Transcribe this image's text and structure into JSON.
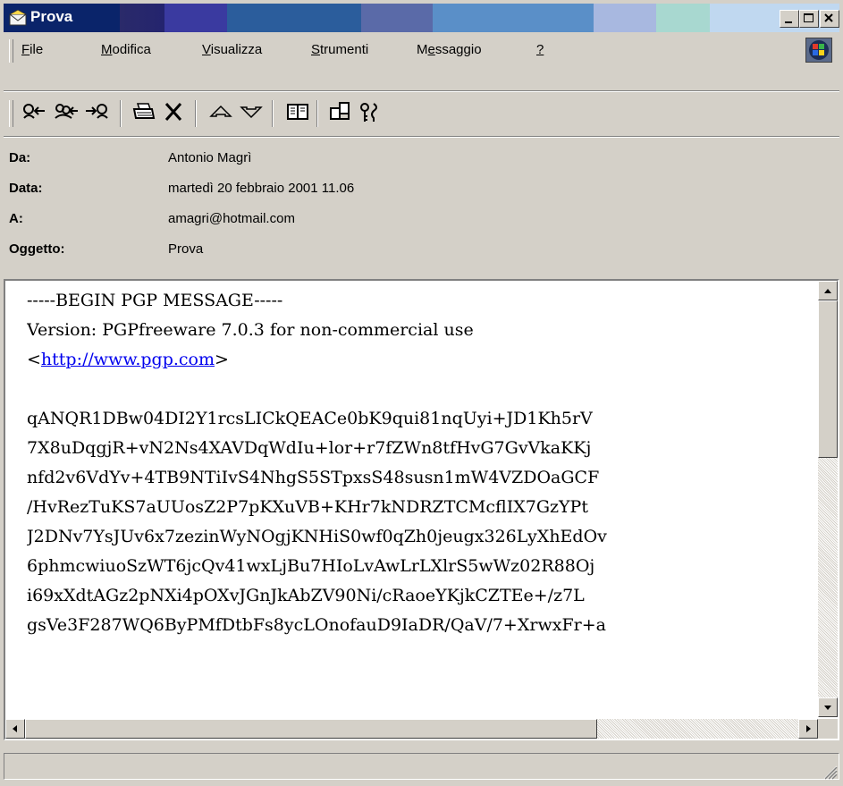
{
  "window": {
    "title": "Prova",
    "controls": {
      "minimize": "minimize-icon",
      "maximize": "maximize-icon",
      "close": "close-icon"
    }
  },
  "menu": {
    "items": [
      {
        "label": "File",
        "accel": "F"
      },
      {
        "label": "Modifica",
        "accel": "M"
      },
      {
        "label": "Visualizza",
        "accel": "V"
      },
      {
        "label": "Strumenti",
        "accel": "S"
      },
      {
        "label": "Messaggio",
        "accel": "e"
      },
      {
        "label": "?",
        "accel": "?"
      }
    ]
  },
  "toolbar": {
    "buttons": [
      "reply-icon",
      "reply-all-icon",
      "forward-icon",
      "print-icon",
      "delete-icon",
      "previous-icon",
      "next-icon",
      "address-book-icon",
      "encoding-icon",
      "security-icon"
    ]
  },
  "header": {
    "from_label": "Da:",
    "from_value": "Antonio Magrì",
    "date_label": "Data:",
    "date_value": "martedì 20 febbraio 2001 11.06",
    "to_label": "A:",
    "to_value": "amagri@hotmail.com",
    "subject_label": "Oggetto:",
    "subject_value": "Prova"
  },
  "message": {
    "line1": "-----BEGIN PGP MESSAGE-----",
    "line2": "Version: PGPfreeware 7.0.3 for non-commercial use",
    "link_prefix": "<",
    "link_text": "http://www.pgp.com",
    "link_suffix": ">",
    "body_lines": [
      "qANQR1DBw04DI2Y1rcsLICkQEACe0bK9qui81nqUyi+JD1Kh5rV",
      "7X8uDqgjR+vN2Ns4XAVDqWdIu+lor+r7fZWn8tfHvG7GvVkaKKj",
      "nfd2v6VdYv+4TB9NTiIvS4NhgS5STpxsS48susn1mW4VZDOaGCF",
      "/HvRezTuKS7aUUosZ2P7pKXuVB+KHr7kNDRZTCMcflIX7GzYPt",
      "J2DNv7YsJUv6x7zezinWyNOgjKNHiS0wf0qZh0jeugx326LyXhEdOv",
      "6phmcwiuoSzWT6jcQv41wxLjBu7HIoLvAwLrLXlrS5wWz02R88Oj",
      "i69xXdtAGz2pNXi4pOXvJGnJkAbZV90Ni/cRaoeYKjkCZTEe+/z7L",
      "gsVe3F287WQ6ByPMfDtbFs8ycLOnofauD9IaDR/QaV/7+XrwxFr+a"
    ]
  },
  "statusbar": {
    "text": ""
  }
}
